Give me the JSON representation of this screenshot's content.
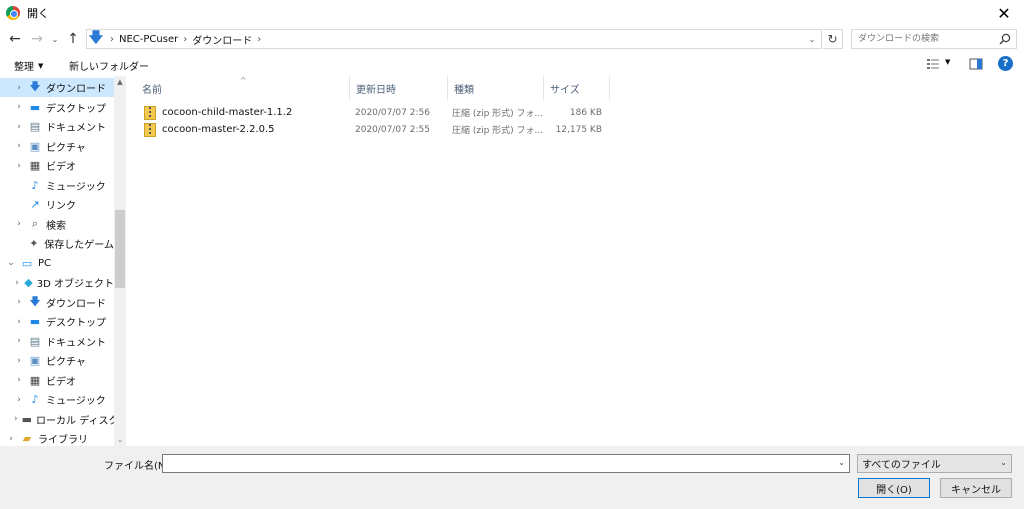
{
  "window": {
    "title": "開く",
    "close": "✕"
  },
  "address": {
    "crumbs": [
      "NEC-PCuser",
      "ダウンロード"
    ],
    "search_placeholder": "ダウンロードの検索"
  },
  "toolbar": {
    "organize": "整理",
    "new_folder": "新しいフォルダー",
    "help": "?"
  },
  "nav": {
    "items": [
      {
        "label": "ダウンロード",
        "icon": "download-icon",
        "chev": "›",
        "selected": true,
        "indent": 1
      },
      {
        "label": "デスクトップ",
        "icon": "desktop-icon",
        "chev": "›",
        "indent": 1
      },
      {
        "label": "ドキュメント",
        "icon": "documents-icon",
        "chev": "›",
        "indent": 1
      },
      {
        "label": "ピクチャ",
        "icon": "pictures-icon",
        "chev": "›",
        "indent": 1
      },
      {
        "label": "ビデオ",
        "icon": "videos-icon",
        "chev": "›",
        "indent": 1
      },
      {
        "label": "ミュージック",
        "icon": "music-icon",
        "chev": "",
        "indent": 1
      },
      {
        "label": "リンク",
        "icon": "link-icon",
        "chev": "",
        "indent": 1
      },
      {
        "label": "検索",
        "icon": "search-icon",
        "chev": "›",
        "indent": 1
      },
      {
        "label": "保存したゲーム",
        "icon": "games-icon",
        "chev": "",
        "indent": 1
      },
      {
        "label": "PC",
        "icon": "pc-icon",
        "chev": "⌄",
        "indent": 0
      },
      {
        "label": "3D オブジェクト",
        "icon": "3d-objects-icon",
        "chev": "›",
        "indent": 1
      },
      {
        "label": "ダウンロード",
        "icon": "download-icon",
        "chev": "›",
        "indent": 1
      },
      {
        "label": "デスクトップ",
        "icon": "desktop-icon",
        "chev": "›",
        "indent": 1
      },
      {
        "label": "ドキュメント",
        "icon": "documents-icon",
        "chev": "›",
        "indent": 1
      },
      {
        "label": "ピクチャ",
        "icon": "pictures-icon",
        "chev": "›",
        "indent": 1
      },
      {
        "label": "ビデオ",
        "icon": "videos-icon",
        "chev": "›",
        "indent": 1
      },
      {
        "label": "ミュージック",
        "icon": "music-icon",
        "chev": "›",
        "indent": 1
      },
      {
        "label": "ローカル ディスク (",
        "icon": "local-disk-icon",
        "chev": "›",
        "indent": 1
      },
      {
        "label": "ライブラリ",
        "icon": "library-icon",
        "chev": "›",
        "indent": 0
      }
    ]
  },
  "columns": {
    "name": "名前",
    "date": "更新日時",
    "type": "種類",
    "size": "サイズ"
  },
  "files": [
    {
      "name": "cocoon-child-master-1.1.2",
      "date": "2020/07/07 2:56",
      "type": "圧縮 (zip 形式) フォ...",
      "size": "186 KB"
    },
    {
      "name": "cocoon-master-2.2.0.5",
      "date": "2020/07/07 2:55",
      "type": "圧縮 (zip 形式) フォ...",
      "size": "12,175 KB"
    }
  ],
  "bottom": {
    "filename_label": "ファイル名(N):",
    "filename_value": "",
    "file_type": "すべてのファイル",
    "open_label": "開く(O)",
    "cancel_label": "キャンセル"
  },
  "colors": {
    "selection": "#cce8ff",
    "accent": "#0078d7"
  }
}
